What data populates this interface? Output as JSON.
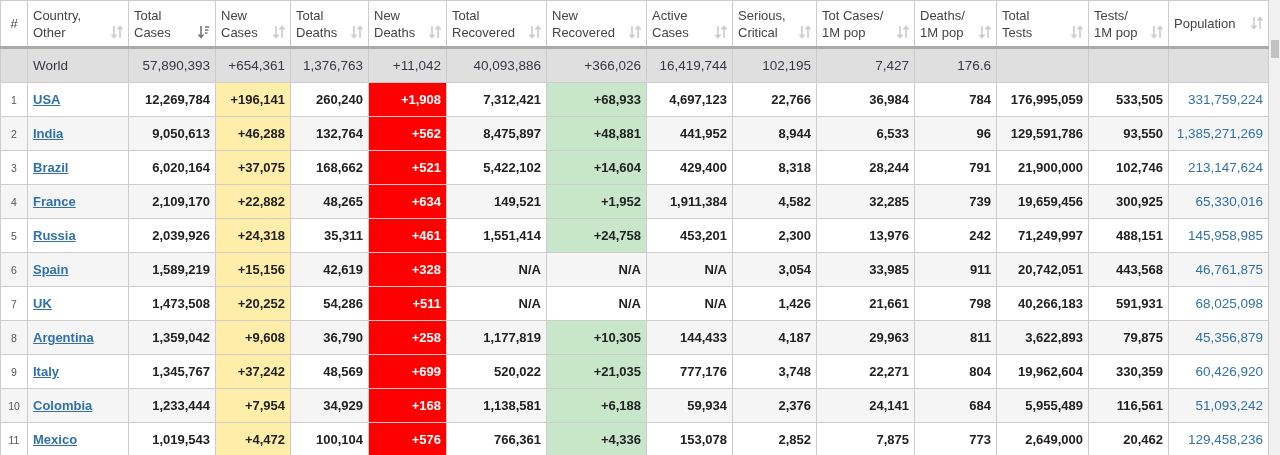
{
  "table": {
    "columns": [
      {
        "label": "#"
      },
      {
        "label": "Country,\nOther",
        "sortable": true,
        "sorted": false
      },
      {
        "label": "Total\nCases",
        "sortable": true,
        "sorted": true
      },
      {
        "label": "New\nCases",
        "sortable": true,
        "sorted": false
      },
      {
        "label": "Total\nDeaths",
        "sortable": true,
        "sorted": false
      },
      {
        "label": "New\nDeaths",
        "sortable": true,
        "sorted": false
      },
      {
        "label": "Total\nRecovered",
        "sortable": true,
        "sorted": false
      },
      {
        "label": "New\nRecovered",
        "sortable": true,
        "sorted": false
      },
      {
        "label": "Active\nCases",
        "sortable": true,
        "sorted": false
      },
      {
        "label": "Serious,\nCritical",
        "sortable": true,
        "sorted": false
      },
      {
        "label": "Tot Cases/\n1M pop",
        "sortable": true,
        "sorted": false
      },
      {
        "label": "Deaths/\n1M pop",
        "sortable": true,
        "sorted": false
      },
      {
        "label": "Total\nTests",
        "sortable": true,
        "sorted": false
      },
      {
        "label": "Tests/\n1M pop",
        "sortable": true,
        "sorted": false
      },
      {
        "label": "Population",
        "sortable": true,
        "sorted": false
      }
    ],
    "total_row": {
      "country": "World",
      "values": [
        "57,890,393",
        "+654,361",
        "1,376,763",
        "+11,042",
        "40,093,886",
        "+366,026",
        "16,419,744",
        "102,195",
        "7,427",
        "176.6"
      ]
    },
    "rows": [
      {
        "rank": "1",
        "country": "USA",
        "values": [
          "12,269,784",
          "+196,141",
          "260,240",
          "+1,908",
          "7,312,421",
          "+68,933",
          "4,697,123",
          "22,766",
          "36,984",
          "784",
          "176,995,059",
          "533,505"
        ],
        "population": "331,759,224",
        "recovered_highlighted": true
      },
      {
        "rank": "2",
        "country": "India",
        "values": [
          "9,050,613",
          "+46,288",
          "132,764",
          "+562",
          "8,475,897",
          "+48,881",
          "441,952",
          "8,944",
          "6,533",
          "96",
          "129,591,786",
          "93,550"
        ],
        "population": "1,385,271,269",
        "recovered_highlighted": true
      },
      {
        "rank": "3",
        "country": "Brazil",
        "values": [
          "6,020,164",
          "+37,075",
          "168,662",
          "+521",
          "5,422,102",
          "+14,604",
          "429,400",
          "8,318",
          "28,244",
          "791",
          "21,900,000",
          "102,746"
        ],
        "population": "213,147,624",
        "recovered_highlighted": true
      },
      {
        "rank": "4",
        "country": "France",
        "values": [
          "2,109,170",
          "+22,882",
          "48,265",
          "+634",
          "149,521",
          "+1,952",
          "1,911,384",
          "4,582",
          "32,285",
          "739",
          "19,659,456",
          "300,925"
        ],
        "population": "65,330,016",
        "recovered_highlighted": true
      },
      {
        "rank": "5",
        "country": "Russia",
        "values": [
          "2,039,926",
          "+24,318",
          "35,311",
          "+461",
          "1,551,414",
          "+24,758",
          "453,201",
          "2,300",
          "13,976",
          "242",
          "71,249,997",
          "488,151"
        ],
        "population": "145,958,985",
        "recovered_highlighted": true
      },
      {
        "rank": "6",
        "country": "Spain",
        "values": [
          "1,589,219",
          "+15,156",
          "42,619",
          "+328",
          "N/A",
          "N/A",
          "N/A",
          "3,054",
          "33,985",
          "911",
          "20,742,051",
          "443,568"
        ],
        "population": "46,761,875",
        "recovered_highlighted": false
      },
      {
        "rank": "7",
        "country": "UK",
        "values": [
          "1,473,508",
          "+20,252",
          "54,286",
          "+511",
          "N/A",
          "N/A",
          "N/A",
          "1,426",
          "21,661",
          "798",
          "40,266,183",
          "591,931"
        ],
        "population": "68,025,098",
        "recovered_highlighted": false
      },
      {
        "rank": "8",
        "country": "Argentina",
        "values": [
          "1,359,042",
          "+9,608",
          "36,790",
          "+258",
          "1,177,819",
          "+10,305",
          "144,433",
          "4,187",
          "29,963",
          "811",
          "3,622,893",
          "79,875"
        ],
        "population": "45,356,879",
        "recovered_highlighted": true
      },
      {
        "rank": "9",
        "country": "Italy",
        "values": [
          "1,345,767",
          "+37,242",
          "48,569",
          "+699",
          "520,022",
          "+21,035",
          "777,176",
          "3,748",
          "22,271",
          "804",
          "19,962,604",
          "330,359"
        ],
        "population": "60,426,920",
        "recovered_highlighted": true
      },
      {
        "rank": "10",
        "country": "Colombia",
        "values": [
          "1,233,444",
          "+7,954",
          "34,929",
          "+168",
          "1,138,581",
          "+6,188",
          "59,934",
          "2,376",
          "24,141",
          "684",
          "5,955,489",
          "116,561"
        ],
        "population": "51,093,242",
        "recovered_highlighted": true
      },
      {
        "rank": "11",
        "country": "Mexico",
        "values": [
          "1,019,543",
          "+4,472",
          "100,104",
          "+576",
          "766,361",
          "+4,336",
          "153,078",
          "2,852",
          "7,875",
          "773",
          "2,649,000",
          "20,462"
        ],
        "population": "129,458,236",
        "recovered_highlighted": true
      }
    ]
  }
}
